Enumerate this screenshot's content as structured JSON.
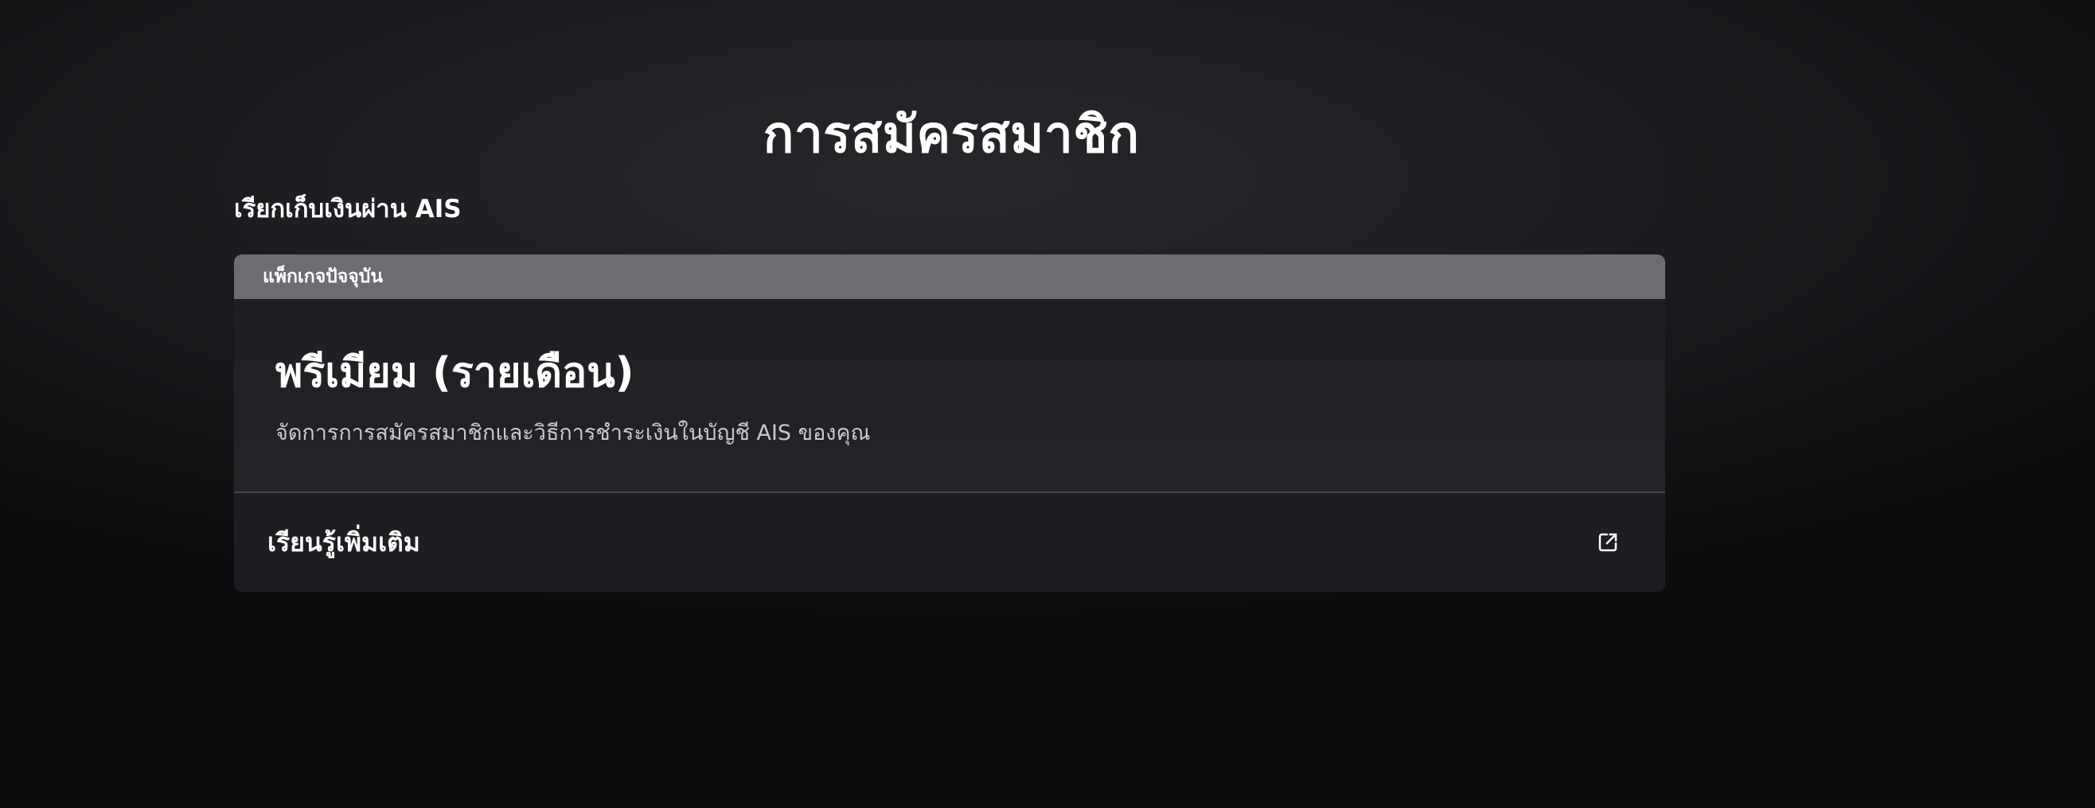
{
  "page": {
    "title": "การสมัครสมาชิก"
  },
  "billing": {
    "heading": "เรียกเก็บเงินผ่าน AIS"
  },
  "plan_card": {
    "header_label": "แพ็กเกจปัจจุบัน",
    "plan_name": "พรีเมียม (รายเดือน)",
    "description": "จัดการการสมัครสมาชิกและวิธีการชำระเงินในบัญชี AIS ของคุณ",
    "learn_more_label": "เรียนรู้เพิ่มเติม",
    "learn_more_icon": "external-link-icon"
  },
  "colors": {
    "background": "#1d1e21",
    "card_header": "#6c6d71",
    "card_body": "#1f2023",
    "text_primary": "#ffffff",
    "text_secondary": "#c8c9cc"
  }
}
